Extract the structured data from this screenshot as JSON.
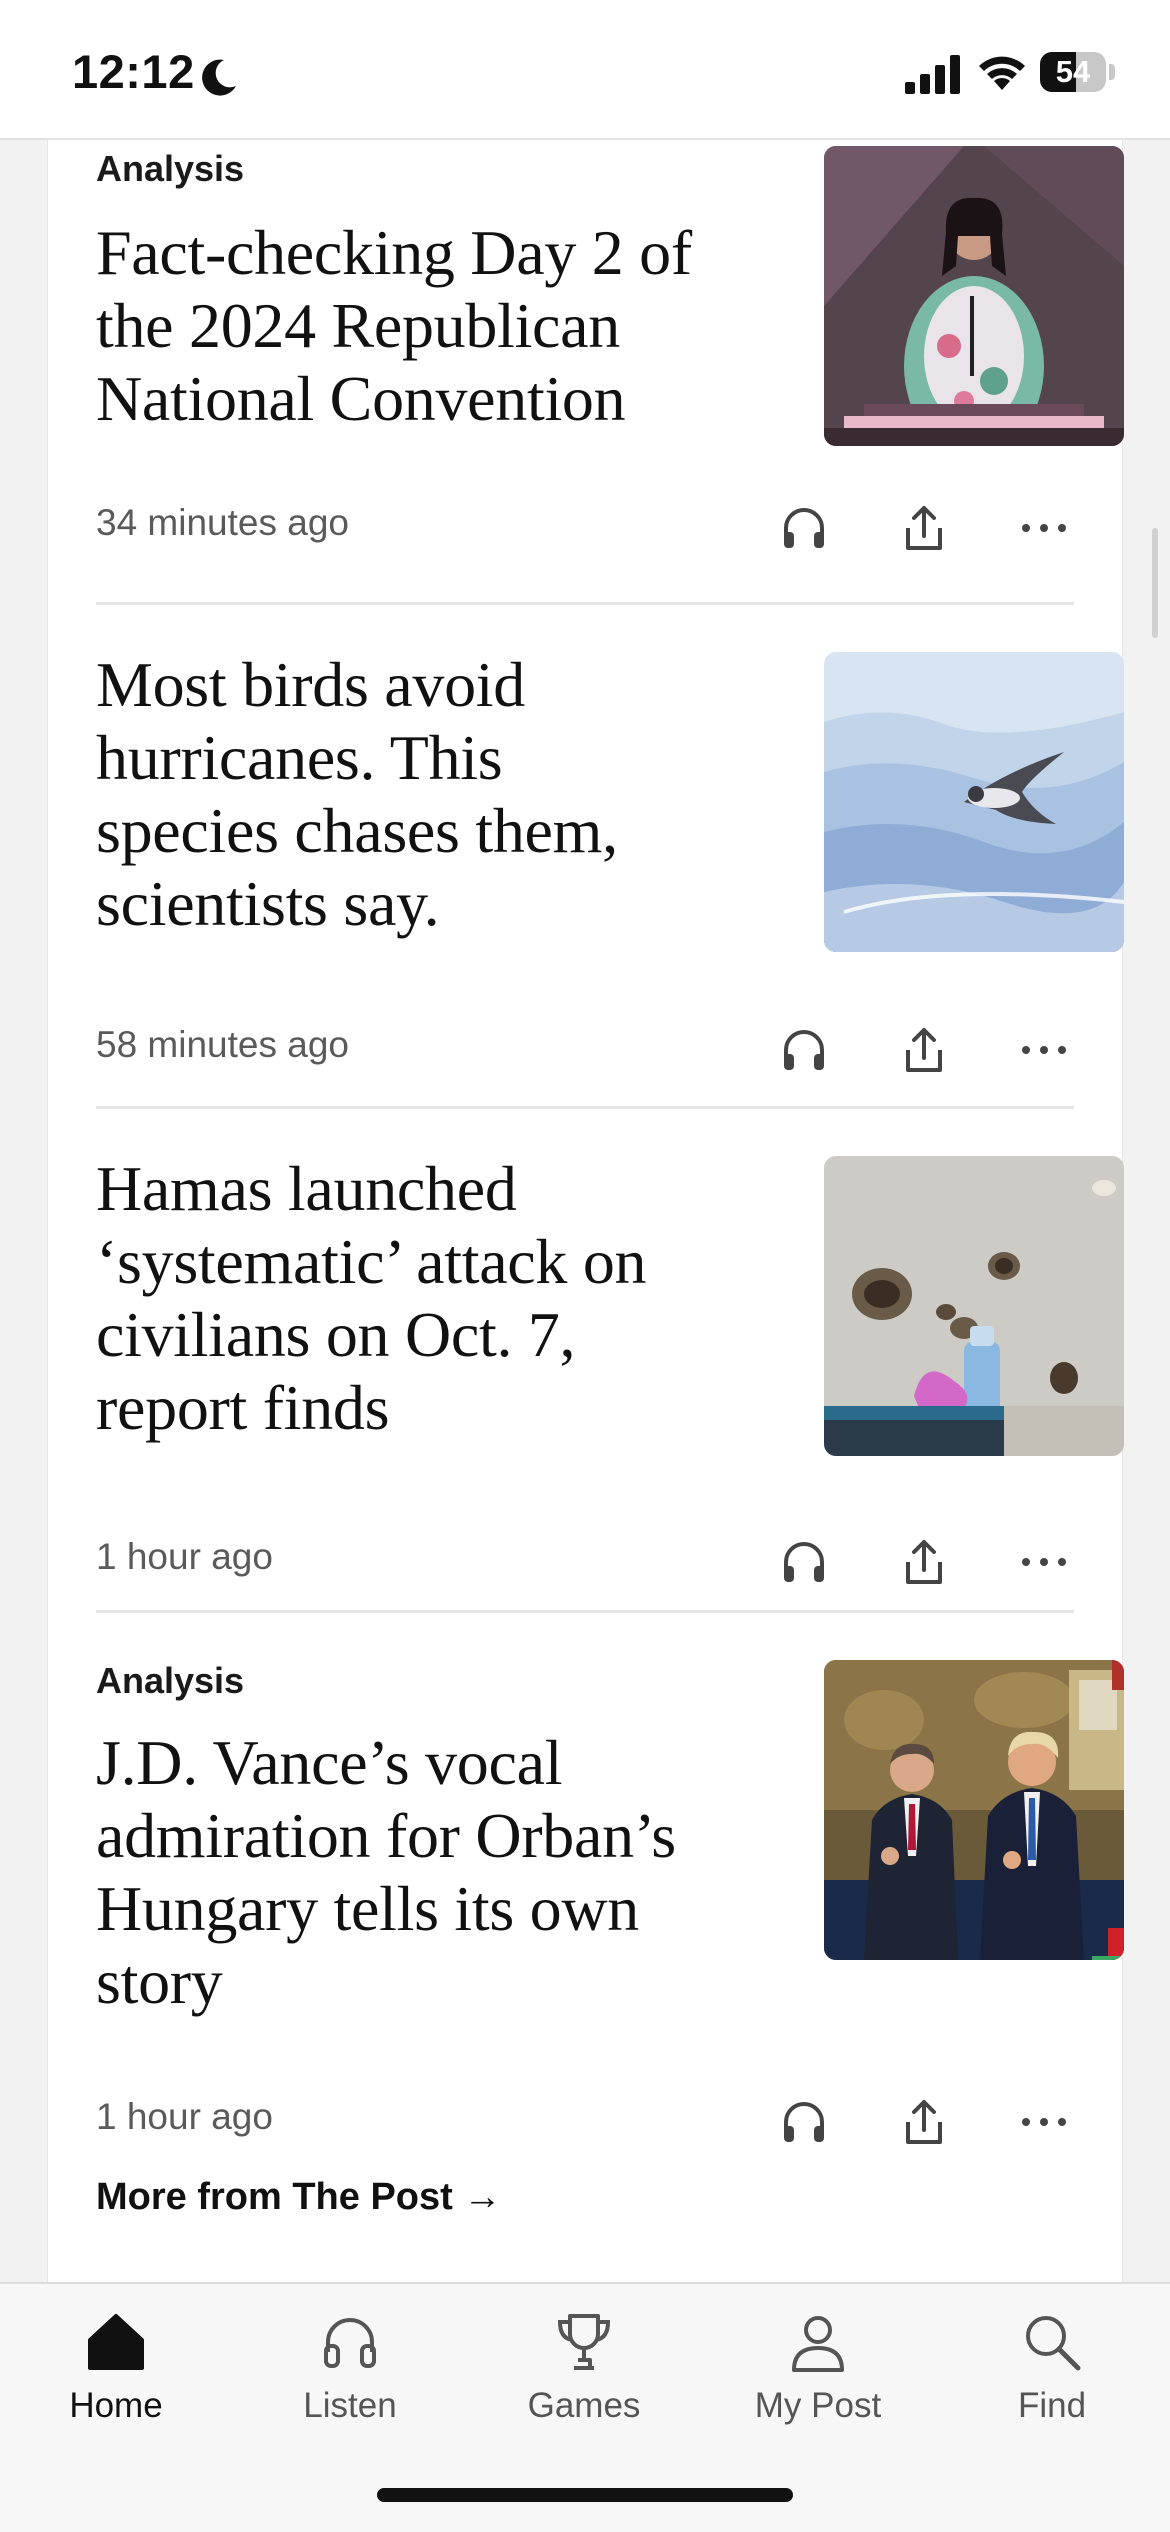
{
  "status_bar": {
    "time": "12:12",
    "battery_level": "54",
    "icons": [
      "moon-icon",
      "signal-icon",
      "wifi-icon",
      "battery-icon"
    ]
  },
  "articles": [
    {
      "kicker": "Analysis",
      "headline_lines": [
        "Fact-checking Day 2 of",
        "the 2024 Republican",
        "National Convention"
      ],
      "timestamp": "34 minutes ago",
      "image": "woman-speaking-at-podium"
    },
    {
      "kicker": "",
      "headline_lines": [
        "Most birds avoid",
        "hurricanes. This",
        "species chases them,",
        "scientists say."
      ],
      "timestamp": "58 minutes ago",
      "image": "seabird-over-ocean"
    },
    {
      "kicker": "",
      "headline_lines": [
        "Hamas launched",
        "‘systematic’ attack on",
        "civilians on Oct. 7,",
        "report finds"
      ],
      "timestamp": "1 hour ago",
      "image": "bullet-holes-wall-baby-bottle"
    },
    {
      "kicker": "Analysis",
      "headline_lines": [
        "J.D. Vance’s vocal",
        "admiration for Orban’s",
        "Hungary tells its own",
        "story"
      ],
      "timestamp": "1 hour ago",
      "image": "two-men-thumbs-up"
    }
  ],
  "article_actions": [
    "headphones-icon",
    "share-icon",
    "more-icon"
  ],
  "more_link": "More from The Post →",
  "tab_bar": {
    "active": "Home",
    "tabs": [
      {
        "label": "Home",
        "icon": "home-icon"
      },
      {
        "label": "Listen",
        "icon": "headphones-icon"
      },
      {
        "label": "Games",
        "icon": "trophy-icon"
      },
      {
        "label": "My Post",
        "icon": "person-icon"
      },
      {
        "label": "Find",
        "icon": "search-icon"
      }
    ]
  }
}
